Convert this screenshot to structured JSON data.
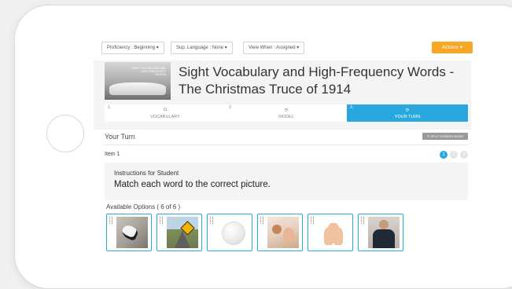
{
  "toolbar": {
    "filters": [
      {
        "label": "Proficiency : Beginning ▾"
      },
      {
        "label": "Sup. Language : None ▾"
      },
      {
        "label": "View When : Assigned ▾"
      }
    ],
    "actions_label": "Actions ▾"
  },
  "lesson": {
    "thumbnail_text": "SIGHT VOCABULARY AND HIGH-FREQUENCY WORDS",
    "title": "Sight Vocabulary and High-Frequency Words - The Christmas Truce of 1914"
  },
  "steps": [
    {
      "num": "1.",
      "label": "VOCABULARY",
      "icon": "camera-icon"
    },
    {
      "num": "2.",
      "label": "MODEL",
      "icon": "refresh-icon"
    },
    {
      "num": "3.",
      "label": "YOUR TURN",
      "icon": "refresh-icon"
    }
  ],
  "section": {
    "title": "Your Turn",
    "split_label": "✎ SPLIT SCREEN MODE"
  },
  "item": {
    "label": "Item 1",
    "pages": [
      "1",
      "2",
      "3"
    ]
  },
  "instructions": {
    "heading": "Instructions for Student",
    "text": "Match each word to the correct picture."
  },
  "options": {
    "title": "Available Options ( 6 of 6 )",
    "items": [
      {
        "image": "glove"
      },
      {
        "image": "road-sign"
      },
      {
        "image": "ball"
      },
      {
        "image": "children"
      },
      {
        "image": "hand"
      },
      {
        "image": "man-in-suit"
      }
    ]
  },
  "colors": {
    "accent": "#29a8e0",
    "actions": "#f5a623"
  }
}
